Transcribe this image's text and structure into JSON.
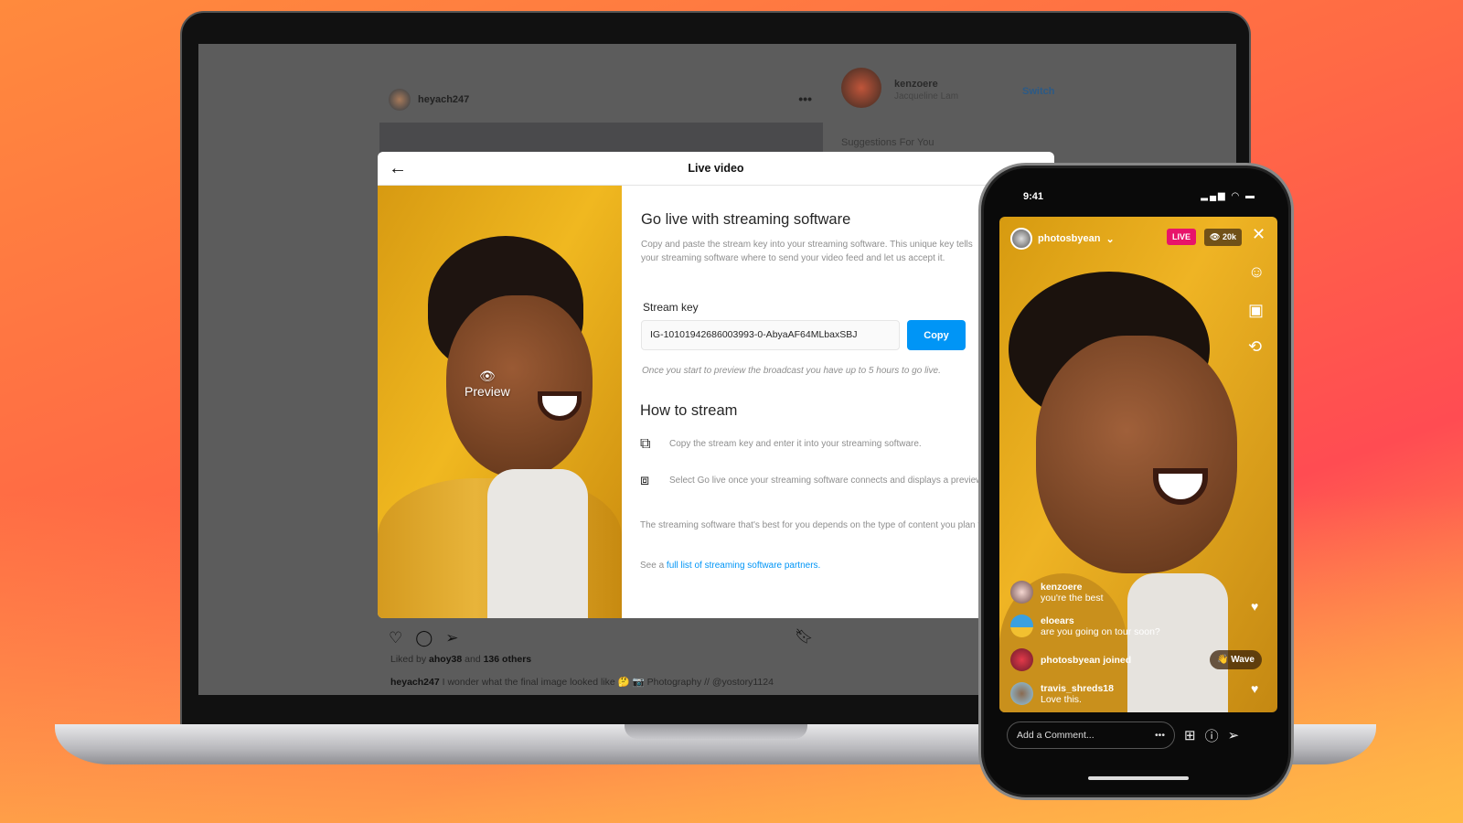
{
  "feed": {
    "post_username": "heyach247",
    "more_label": "•••",
    "liked_by_prefix": "Liked by",
    "liked_by_user": "ahoy38",
    "liked_by_and": "and",
    "liked_by_others": "136 others",
    "caption_user": "heyach247",
    "caption_text": "I wonder what the final image looked like 🤔 📷 Photography // @yostory1124"
  },
  "sidebar": {
    "username": "kenzoere",
    "subtitle": "Jacqueline Lam",
    "switch_label": "Switch",
    "suggestions_label": "Suggestions For You"
  },
  "modal": {
    "title": "Live video",
    "preview_label": "Preview",
    "heading": "Go live with streaming software",
    "description": "Copy and paste the stream key into your streaming software. This unique key tells your streaming software where to send your video feed and let us accept it.",
    "stream_key_label": "Stream key",
    "stream_key_value": "IG-10101942686003993-0-AbyaAF64MLbaxSBJ",
    "copy_label": "Copy",
    "note": "Once you start to preview the broadcast you have up to 5 hours to go live.",
    "how_heading": "How to stream",
    "steps": [
      {
        "icon": "copy-icon",
        "text": "Copy the stream key and enter it into your streaming software."
      },
      {
        "icon": "screen-play-icon",
        "text": "Select Go live once your streaming software connects and displays a preview."
      }
    ],
    "best_text": "The streaming software that's best for you depends on the type of content you plan to stream.",
    "see_prefix": "See a",
    "partners_link": "full list of streaming software partners."
  },
  "phone": {
    "time": "9:41",
    "username": "photosbyean",
    "live_badge": "LIVE",
    "viewers": "20k",
    "comments": [
      {
        "user": "kenzoere",
        "text": "you're the best"
      },
      {
        "user": "eloears",
        "text": "are you going on tour soon?"
      },
      {
        "user": "photosbyean joined",
        "text": ""
      },
      {
        "user": "travis_shreds18",
        "text": "Love this."
      }
    ],
    "wave_label": "👋 Wave",
    "comment_placeholder": "Add a Comment...",
    "comment_more": "•••",
    "colors": {
      "live": "#e8146a",
      "accent": "#0095f6"
    }
  }
}
